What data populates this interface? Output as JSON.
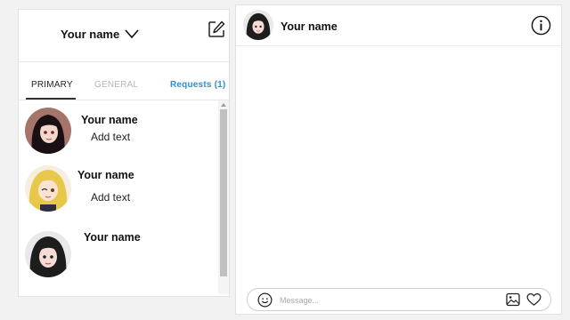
{
  "sidebar": {
    "account_name": "Your name",
    "icons": {
      "chevron": "chevron-down-icon",
      "compose": "compose-icon"
    },
    "tabs": [
      {
        "label": "PRIMARY",
        "active": true
      },
      {
        "label": "GENERAL",
        "active": false
      },
      {
        "label": "Requests (1)",
        "active": false
      }
    ],
    "conversations": [
      {
        "name": "Your name",
        "preview": "Add text",
        "avatar": "dark-haired-girl-avatar"
      },
      {
        "name": "Your name",
        "preview": "Add text",
        "avatar": "blonde-girl-avatar"
      },
      {
        "name": "Your name",
        "preview": "",
        "avatar": "dark-haired-boy-avatar"
      }
    ]
  },
  "chat": {
    "title": "Your name",
    "avatar": "dark-haired-boy-avatar",
    "info_icon": "info-icon",
    "composer": {
      "placeholder": "Message...",
      "value": "",
      "icons": [
        "emoji-icon",
        "image-icon",
        "heart-icon"
      ]
    }
  },
  "colors": {
    "accent": "#2f8fd6",
    "inactive_tab": "#b5b5b5",
    "background": "#f2f2f2"
  }
}
